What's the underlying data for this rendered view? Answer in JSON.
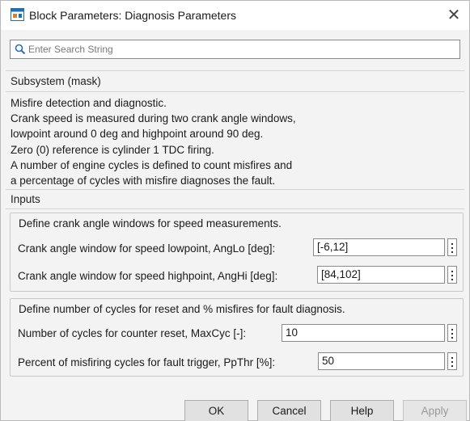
{
  "window": {
    "title": "Block Parameters: Diagnosis Parameters",
    "close_glyph": "✕"
  },
  "search": {
    "placeholder": "Enter Search String",
    "value": ""
  },
  "mask": {
    "heading": "Subsystem (mask)",
    "description_lines": [
      "Misfire detection and diagnostic.",
      "Crank speed is measured during two crank angle windows,",
      "lowpoint around 0 deg and highpoint around 90 deg.",
      "Zero (0) reference is cylinder 1 TDC firing.",
      "A number of engine cycles is defined to count misfires and",
      "a percentage of cycles with misfire diagnoses the fault."
    ]
  },
  "inputs": {
    "heading": "Inputs",
    "groups": [
      {
        "label": "Define crank angle windows for speed measurements.",
        "params": [
          {
            "label": "Crank angle window for speed lowpoint, AngLo [deg]:",
            "value": "[-6,12]"
          },
          {
            "label": "Crank angle window for speed highpoint, AngHi [deg]:",
            "value": "[84,102]"
          }
        ]
      },
      {
        "label": "Define number of cycles for reset and % misfires for fault diagnosis.",
        "params": [
          {
            "label": "Number of cycles for counter reset, MaxCyc [-]:",
            "value": "10"
          },
          {
            "label": "Percent of misfiring cycles for fault trigger, PpThr [%]:",
            "value": "50"
          }
        ]
      }
    ]
  },
  "buttons": {
    "ok": "OK",
    "cancel": "Cancel",
    "help": "Help",
    "apply": "Apply"
  },
  "icons": {
    "app": "simulink-block-icon",
    "search": "search-icon",
    "close": "close-icon",
    "menu": "kebab-menu-icon"
  },
  "colors": {
    "window_bg": "#f3f3f3",
    "titlebar_bg": "#ffffff",
    "app_icon_blue": "#1f6fb5",
    "app_icon_orange": "#d9822b"
  }
}
